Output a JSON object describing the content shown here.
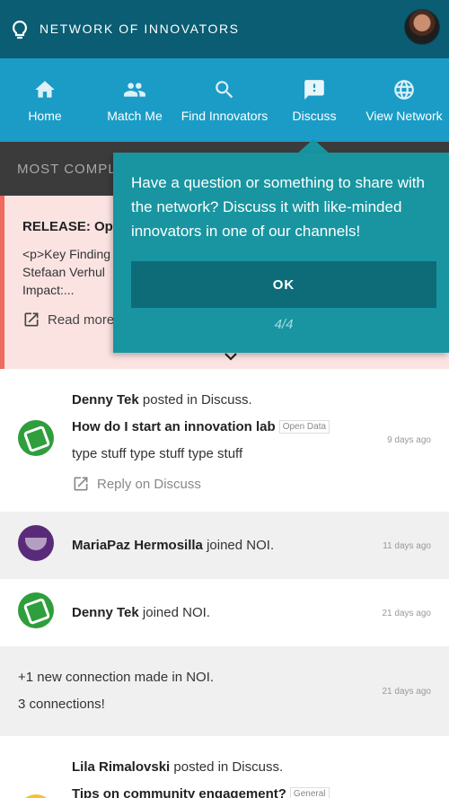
{
  "header": {
    "brand": "NETWORK OF INNOVATORS",
    "logo_icon": "lightbulb-icon",
    "avatar_icon": "user-avatar"
  },
  "nav": {
    "items": [
      {
        "label": "Home",
        "icon": "home-icon"
      },
      {
        "label": "Match Me",
        "icon": "people-icon"
      },
      {
        "label": "Find Innovators",
        "icon": "search-icon"
      },
      {
        "label": "Discuss",
        "icon": "chat-alert-icon"
      },
      {
        "label": "View Network",
        "icon": "globe-icon"
      }
    ],
    "active_index": 3
  },
  "section": {
    "title": "MOST COMPL"
  },
  "featured": {
    "title": "RELEASE: Ope",
    "body": "<p>Key Finding\nStefaan Verhul\nImpact:...",
    "read_more": "Read more"
  },
  "tooltip": {
    "text": "Have a question or something to share with the network? Discuss it with like-minded innovators in one of our channels!",
    "ok": "OK",
    "step": "4/4"
  },
  "feed": [
    {
      "user": "Denny Tek",
      "action": " posted in Discuss.",
      "title": "How do I start an innovation lab",
      "tag": "Open Data",
      "body": "type stuff type stuff type stuff",
      "reply": "Reply on Discuss",
      "time": "9 days ago"
    },
    {
      "user": "MariaPaz Hermosilla",
      "action": " joined NOI.",
      "time": "11 days ago"
    },
    {
      "user": "Denny Tek",
      "action": " joined NOI.",
      "time": "21 days ago"
    },
    {
      "line1": "+1 new connection made in NOI.",
      "line2": "3 connections!",
      "time": "21 days ago"
    },
    {
      "user": "Lila Rimalovski",
      "action": " posted in Discuss.",
      "title": "Tips on community engagement?",
      "tag": "General"
    }
  ],
  "colors": {
    "header": "#0a5d72",
    "nav": "#1a9cc7",
    "section": "#3b3b3b",
    "featured_bg": "#fbe3e2",
    "featured_accent": "#ef6a5f",
    "tooltip": "#1895a0",
    "tooltip_button": "#0e6b78"
  }
}
